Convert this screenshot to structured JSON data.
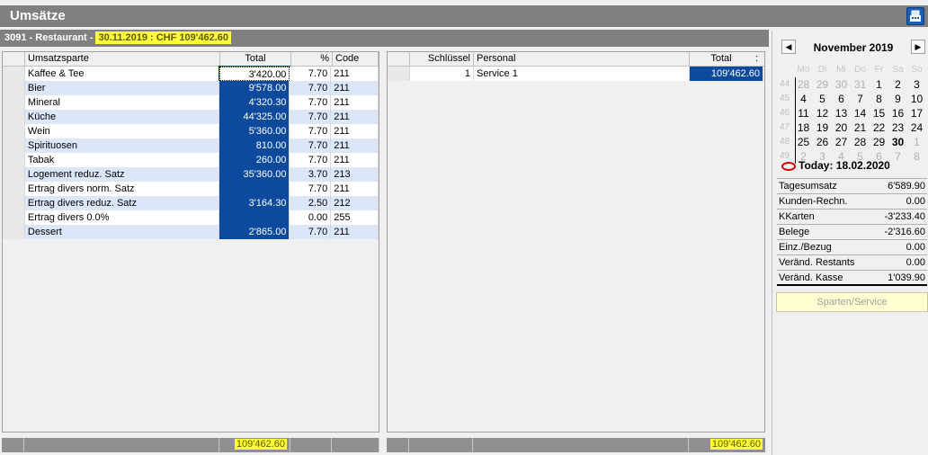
{
  "window": {
    "title": "Umsätze",
    "button_icon": "register-icon"
  },
  "header": {
    "prefix": "3091 - Restaurant - ",
    "highlight": "30.11.2019 : CHF 109'462.60"
  },
  "sales_grid": {
    "columns": [
      "Umsatzsparte",
      "Total",
      "%",
      "Code"
    ],
    "rows": [
      {
        "name": "Kaffee & Tee",
        "total": "3'420.00",
        "pct": "7.70",
        "code": "211"
      },
      {
        "name": "Bier",
        "total": "9'578.00",
        "pct": "7.70",
        "code": "211"
      },
      {
        "name": "Mineral",
        "total": "4'320.30",
        "pct": "7.70",
        "code": "211"
      },
      {
        "name": "Küche",
        "total": "44'325.00",
        "pct": "7.70",
        "code": "211"
      },
      {
        "name": "Wein",
        "total": "5'360.00",
        "pct": "7.70",
        "code": "211"
      },
      {
        "name": "Spirituosen",
        "total": "810.00",
        "pct": "7.70",
        "code": "211"
      },
      {
        "name": "Tabak",
        "total": "260.00",
        "pct": "7.70",
        "code": "211"
      },
      {
        "name": "Logement reduz. Satz",
        "total": "35'360.00",
        "pct": "3.70",
        "code": "213"
      },
      {
        "name": "Ertrag divers norm. Satz",
        "total": "",
        "pct": "7.70",
        "code": "211"
      },
      {
        "name": "Ertrag divers reduz. Satz",
        "total": "3'164.30",
        "pct": "2.50",
        "code": "212"
      },
      {
        "name": "Ertrag divers 0.0%",
        "total": "",
        "pct": "0.00",
        "code": "255"
      },
      {
        "name": "Dessert",
        "total": "2'865.00",
        "pct": "7.70",
        "code": "211"
      }
    ],
    "footer_total": "109'462.60"
  },
  "staff_grid": {
    "columns": [
      "Schlüssel",
      "Personal",
      "Total",
      ":"
    ],
    "rows": [
      {
        "key": "1",
        "name": "Service 1",
        "total": "109'462.60"
      }
    ],
    "footer_total": "109'462.60"
  },
  "calendar": {
    "prev": "◀",
    "next": "▶",
    "title": "November 2019",
    "dow": [
      "Mo",
      "Di",
      "Mi",
      "Do",
      "Fr",
      "Sa",
      "So"
    ],
    "weeks": [
      {
        "wk": "44",
        "days": [
          "28",
          "29",
          "30",
          "31",
          "1",
          "2",
          "3"
        ]
      },
      {
        "wk": "45",
        "days": [
          "4",
          "5",
          "6",
          "7",
          "8",
          "9",
          "10"
        ]
      },
      {
        "wk": "46",
        "days": [
          "11",
          "12",
          "13",
          "14",
          "15",
          "16",
          "17"
        ]
      },
      {
        "wk": "47",
        "days": [
          "18",
          "19",
          "20",
          "21",
          "22",
          "23",
          "24"
        ]
      },
      {
        "wk": "48",
        "days": [
          "25",
          "26",
          "27",
          "28",
          "29",
          "30",
          "1"
        ]
      },
      {
        "wk": "49",
        "days": [
          "2",
          "3",
          "4",
          "5",
          "6",
          "7",
          "8"
        ]
      }
    ],
    "today_label": "Today: 18.02.2020"
  },
  "summary": [
    {
      "label": "Tagesumsatz",
      "value": "6'589.90"
    },
    {
      "label": "Kunden-Rechn.",
      "value": "0.00"
    },
    {
      "label": "KKarten",
      "value": "-3'233.40"
    },
    {
      "label": "Belege",
      "value": "-2'316.60"
    },
    {
      "label": "Einz./Bezug",
      "value": "0.00"
    },
    {
      "label": "Veränd. Restants",
      "value": "0.00"
    },
    {
      "label": "Veränd. Kasse",
      "value": "1'039.90"
    }
  ],
  "sparten_button": "Sparten/Service"
}
